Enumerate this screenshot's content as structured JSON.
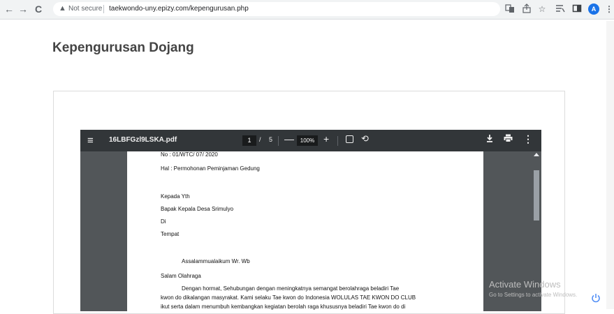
{
  "browser": {
    "back": "←",
    "forward": "→",
    "reload": "C",
    "security_icon": "▲",
    "security_label": "Not secure",
    "url": "taekwondo-uny.epizy.com/kepengurusan.php",
    "avatar_letter": "A"
  },
  "page": {
    "title": "Kepengurusan Dojang"
  },
  "pdf": {
    "filename": "16LBFGzl9LSKA.pdf",
    "current_page": "1",
    "slash": "/",
    "total_pages": "5",
    "zoom": "100%",
    "minus": "—",
    "plus": "+",
    "menu": "≡",
    "more": "⋮"
  },
  "letter": {
    "no": "No      : 01/WTC/ 07/ 2020",
    "hal": "Hal     : Permohonan Peminjaman Gedung",
    "kepada": "Kepada Yth",
    "bapak": "Bapak Kepala Desa Srimulyo",
    "di": "Di",
    "tempat": "Tempat",
    "greeting": "Assalammualaikum Wr. Wb",
    "salam": "Salam Olahraga",
    "para1": "Dengan hormat, Sehubungan dengan meningkatnya semangat berolahraga beladiri Tae",
    "para2": "kwon do dikalangan masyrakat. Kami selaku Tae kwon do Indonesia  WOLULAS TAE KWON DO CLUB",
    "para3": "ikut serta dalam menumbuh kembangkan kegiatan berolah raga khususnya beladiri Tae kwon do di"
  },
  "watermark": {
    "title": "Activate Windows",
    "subtitle": "Go to Settings to activate Windows."
  }
}
